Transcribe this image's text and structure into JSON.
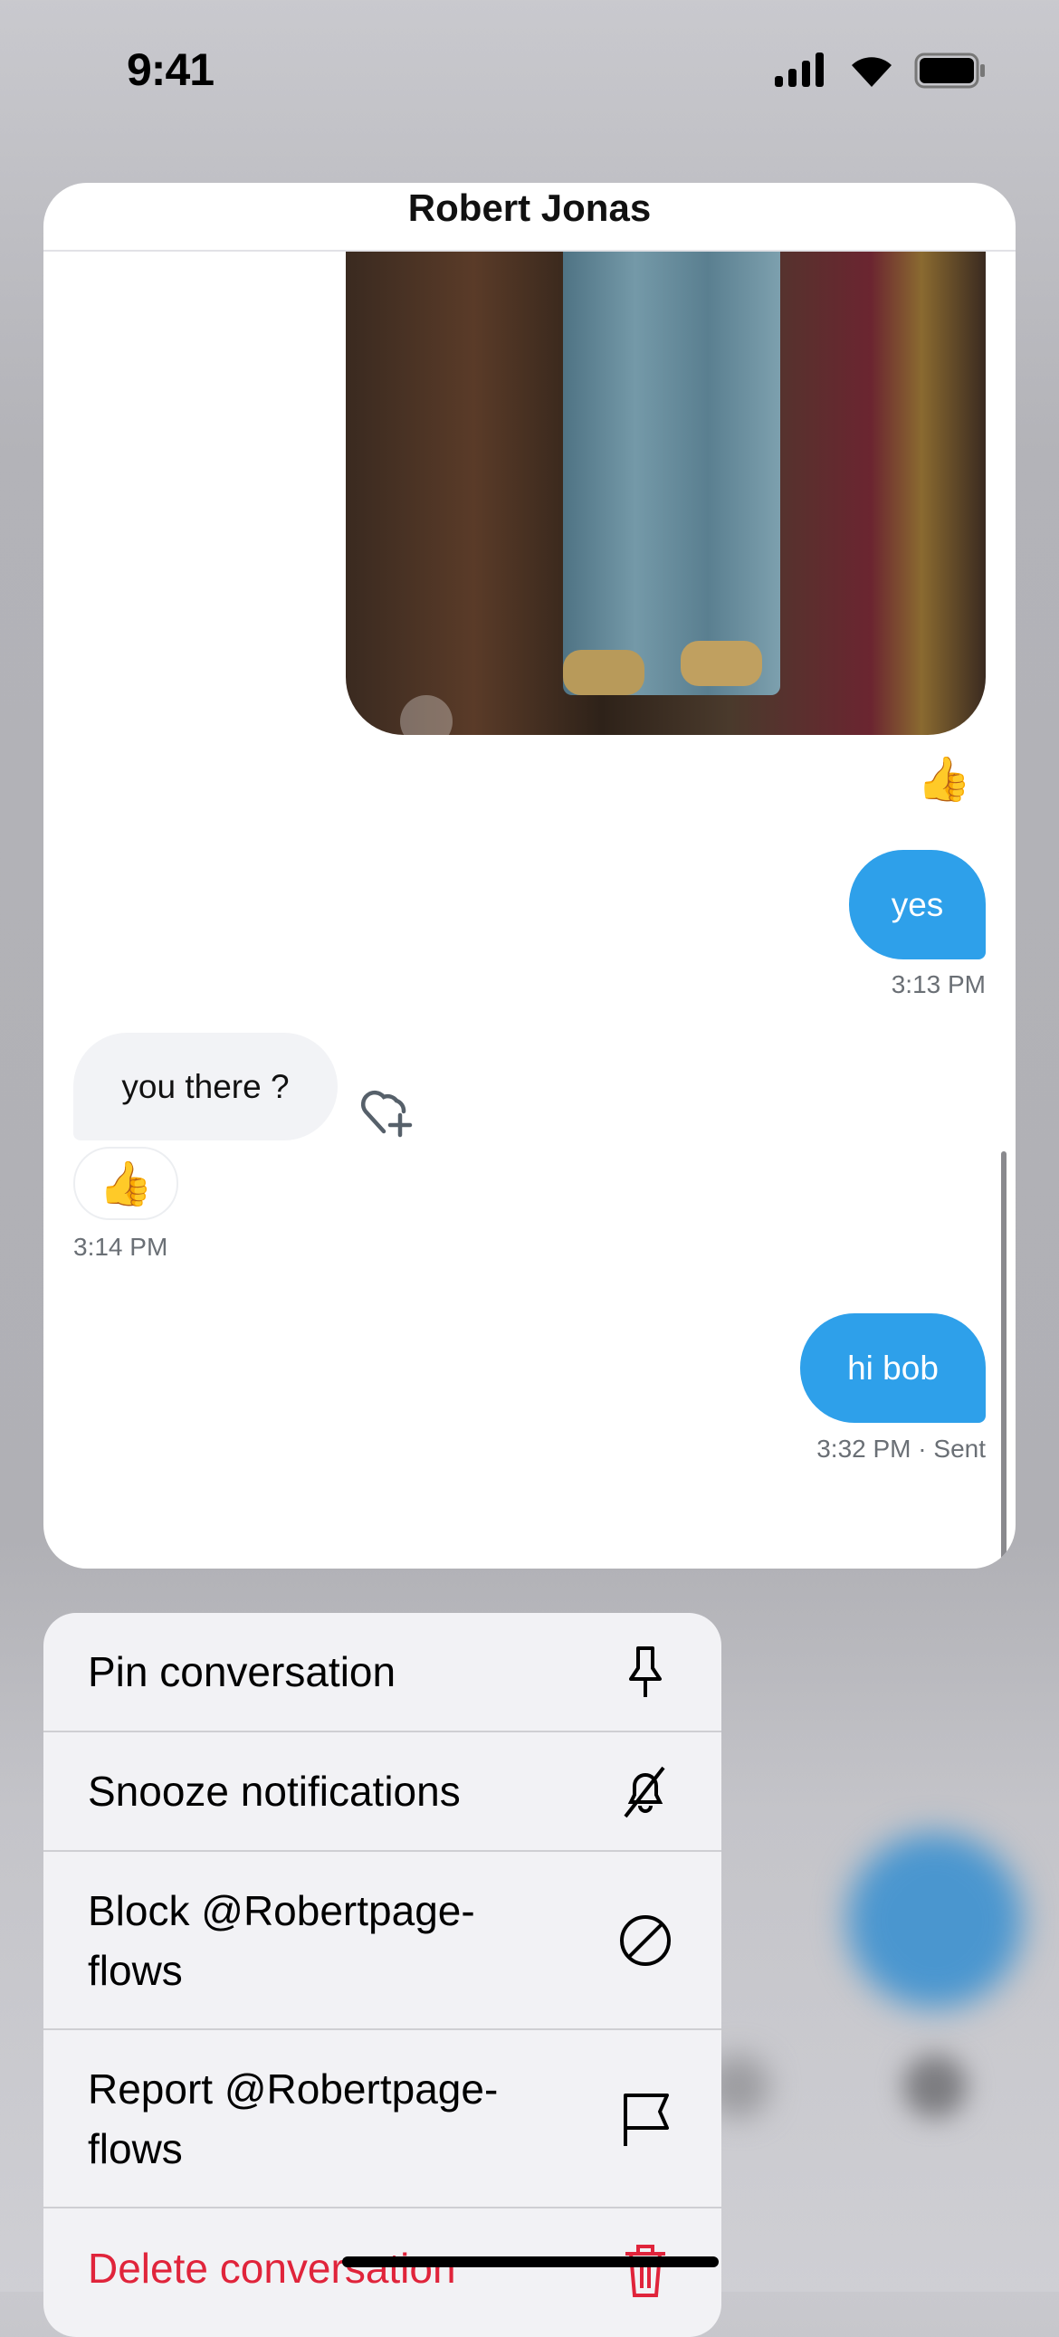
{
  "status_bar": {
    "time": "9:41"
  },
  "conversation": {
    "title": "Robert Jonas",
    "messages": [
      {
        "direction": "out",
        "type": "image",
        "reaction": "👍"
      },
      {
        "direction": "out",
        "text": "yes",
        "time": "3:13 PM"
      },
      {
        "direction": "in",
        "text": "you there ?",
        "reaction": "👍",
        "time": "3:14 PM"
      },
      {
        "direction": "out",
        "text": "hi bob",
        "time": "3:32 PM",
        "status": "· Sent"
      }
    ]
  },
  "menu": {
    "items": [
      {
        "label": "Pin conversation",
        "icon": "pin-icon"
      },
      {
        "label": "Snooze notifications",
        "icon": "bell-slash-icon"
      },
      {
        "label": "Block @Robertpage-flows",
        "icon": "block-icon"
      },
      {
        "label": "Report @Robertpage-flows",
        "icon": "flag-icon"
      },
      {
        "label": "Delete conversation",
        "icon": "trash-icon",
        "color": "#e0243b"
      }
    ]
  },
  "colors": {
    "outgoing_bubble": "#2ea0ea",
    "incoming_bubble": "#f2f3f6",
    "destructive": "#e0243b"
  }
}
